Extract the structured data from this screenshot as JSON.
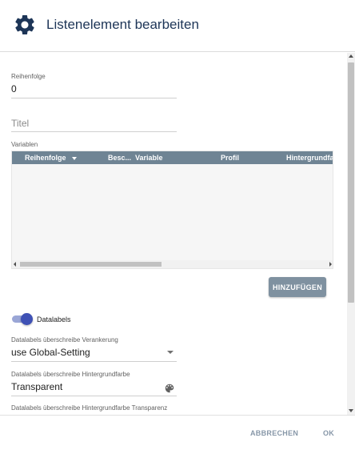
{
  "dialog": {
    "title": "Listenelement bearbeiten",
    "header_icon": "gear-icon"
  },
  "fields": {
    "order": {
      "label": "Reihenfolge",
      "value": "0"
    },
    "title": {
      "placeholder": "Titel"
    }
  },
  "variables_table": {
    "label": "Variablen",
    "columns": [
      "Reihenfolge",
      "Besc...",
      "Variable",
      "Profil",
      "Hintergrundfarbe"
    ],
    "sort_indicator": "arrow-down-icon",
    "rows": []
  },
  "add_button": {
    "label": "HINZUFÜGEN"
  },
  "datalabels_toggle": {
    "label": "Datalabels",
    "on": true
  },
  "anchoring_select": {
    "label": "Datalabels überschreibe Verankerung",
    "value": "use Global-Setting"
  },
  "background_color": {
    "label": "Datalabels überschreibe Hintergrundfarbe",
    "value": "Transparent",
    "icon": "palette-icon"
  },
  "background_transparency": {
    "label": "Datalabels überschreibe Hintergrundfarbe Transparenz"
  },
  "footer": {
    "cancel_label": "ABBRECHEN",
    "ok_label": "OK"
  },
  "colors": {
    "title": "#1d3557",
    "table_header": "#6f8494",
    "accent": "#3f51b5",
    "button": "#7f91a0",
    "footer_button": "#8797a8"
  }
}
